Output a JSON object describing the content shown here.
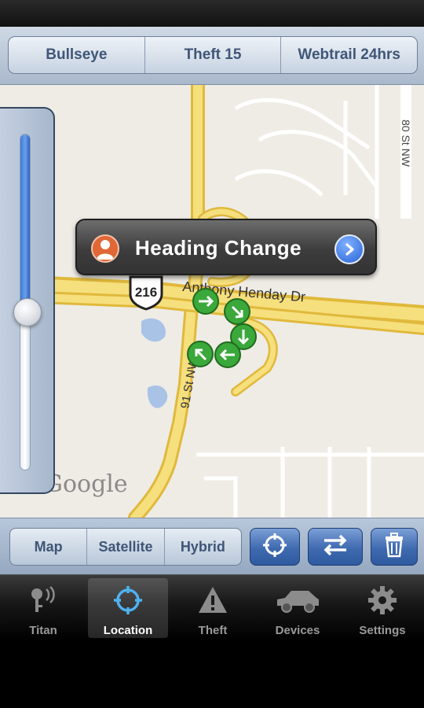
{
  "top_tabs": [
    "Bullseye",
    "Theft 15",
    "Webtrail 24hrs"
  ],
  "map": {
    "highway_shield": "216",
    "road_labels": [
      "Anthony Henday Dr",
      "91 St NW",
      "80 St NW"
    ],
    "attribution": "Google"
  },
  "zoom": {
    "level": 0.53
  },
  "callout": {
    "title": "Heading Change",
    "icon": "person-icon",
    "action_icon": "chevron-right-icon"
  },
  "map_type": {
    "options": [
      "Map",
      "Satellite",
      "Hybrid"
    ],
    "selected": "Map"
  },
  "toolbar": {
    "icons": [
      "locate-icon",
      "swap-arrows-icon",
      "trash-icon"
    ]
  },
  "tab_bar": {
    "selected": "Location",
    "items": [
      {
        "label": "Titan",
        "icon": "key-signal-icon"
      },
      {
        "label": "Location",
        "icon": "crosshair-icon"
      },
      {
        "label": "Theft",
        "icon": "warning-icon"
      },
      {
        "label": "Devices",
        "icon": "car-icon"
      },
      {
        "label": "Settings",
        "icon": "gear-icon"
      }
    ]
  },
  "colors": {
    "accent": "#3f6ab0",
    "marker": "#3aa83a"
  }
}
